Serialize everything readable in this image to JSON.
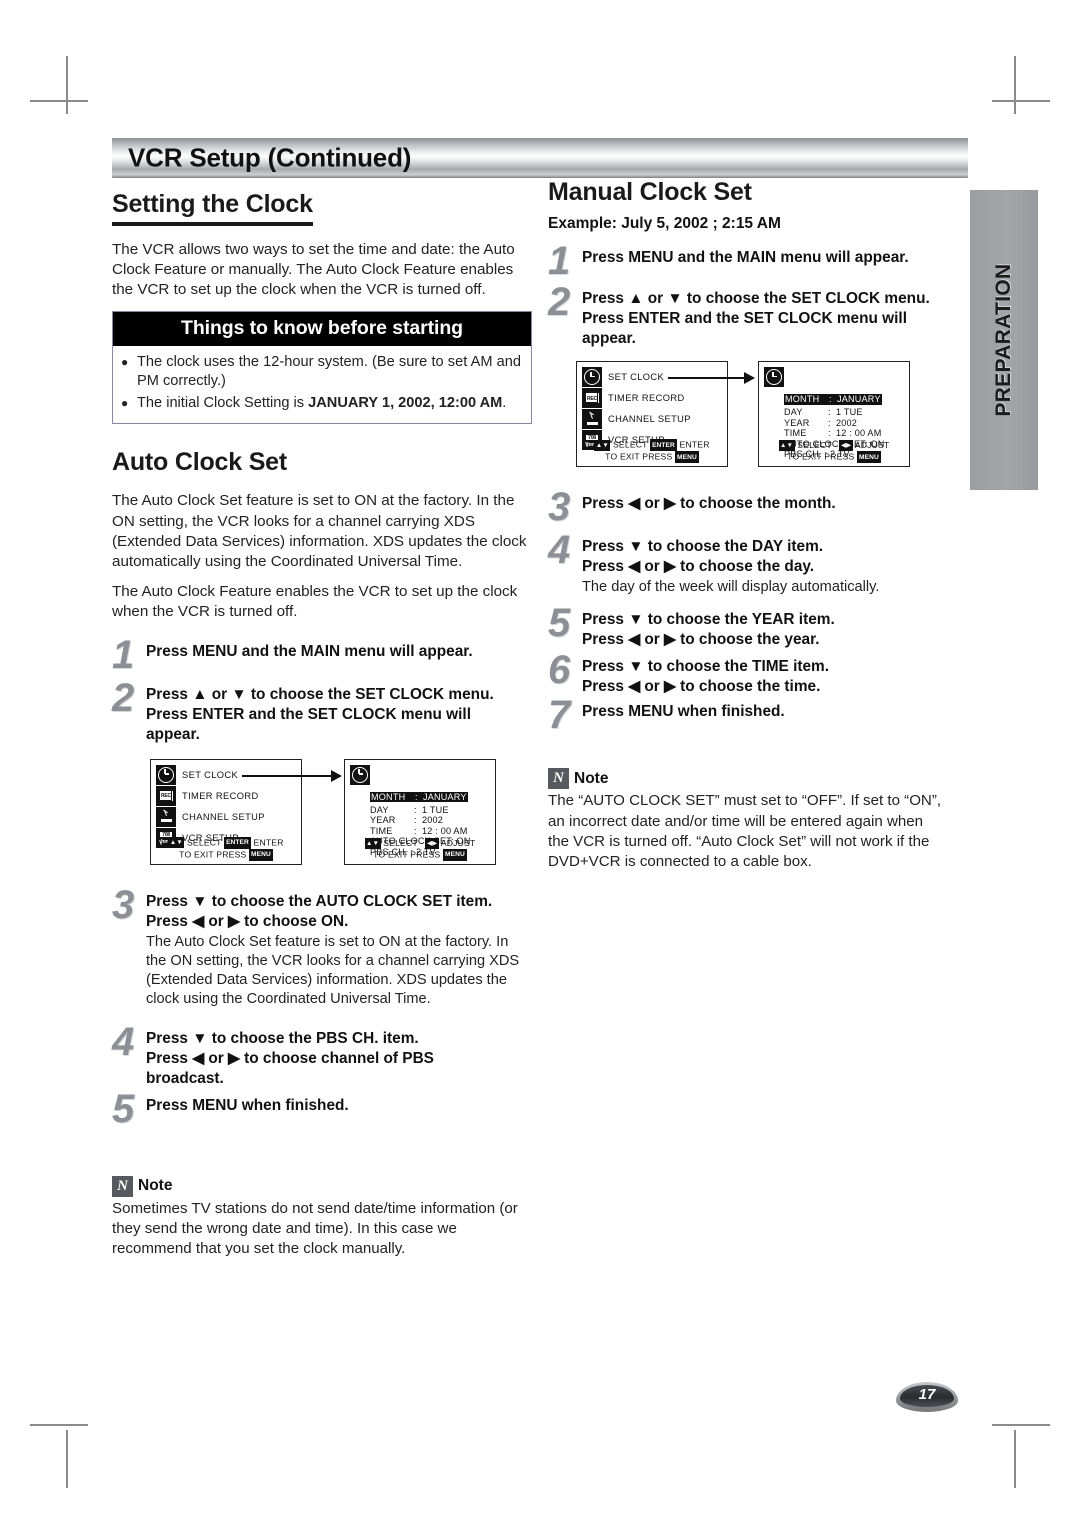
{
  "header": {
    "title": "VCR Setup (Continued)"
  },
  "side_tab": {
    "label": "PREPARATION"
  },
  "page_number": "17",
  "left_column": {
    "section_title": "Setting the Clock",
    "intro": "The VCR allows two ways to set the time and date: the Auto Clock Feature or manually. The Auto Clock Feature enables the VCR to set up the clock when the VCR is turned off.",
    "things_to_know": {
      "title": "Things to know before starting",
      "bullet_char": "●",
      "items": [
        {
          "text": "The clock uses the 12-hour system. (Be sure to set AM and PM correctly.)",
          "bold_tail": ""
        },
        {
          "text": "The initial Clock Setting is ",
          "bold_tail": "JANUARY 1, 2002, 12:00 AM",
          "after": "."
        }
      ]
    },
    "auto_clock": {
      "title": "Auto Clock Set",
      "paragraph_1": "The Auto Clock Set feature is set to ON at the factory. In the ON setting, the VCR looks for a channel carrying XDS (Extended Data Services) information. XDS updates the clock automatically using the Coordinated Universal Time.",
      "paragraph_2": "The Auto Clock Feature enables the VCR to set up the clock when the VCR is turned off.",
      "steps": [
        {
          "num": "1",
          "lines": [
            "Press MENU and the MAIN menu will appear."
          ],
          "sub": []
        },
        {
          "num": "2",
          "lines": [
            "Press ▲ or ▼ to choose the SET CLOCK menu.",
            "Press ENTER and the SET CLOCK menu will",
            "appear."
          ],
          "sub": []
        },
        {
          "num": "3",
          "lines": [
            "Press ▼ to choose the AUTO CLOCK SET item.",
            "Press ◀ or ▶ to choose ON."
          ],
          "sub": [
            "The Auto Clock Set feature is set to ON at the factory. In the ON setting, the VCR looks for a channel carrying XDS (Extended Data Services) information. XDS updates the clock using the Coordinated Universal Time."
          ]
        },
        {
          "num": "4",
          "lines": [
            "Press ▼ to choose the PBS CH. item.",
            "Press ◀ or ▶ to choose channel of PBS",
            "broadcast."
          ],
          "sub": []
        },
        {
          "num": "5",
          "lines": [
            "Press MENU when finished."
          ],
          "sub": []
        }
      ],
      "note": {
        "icon_letter": "N",
        "title": "Note",
        "body": "Sometimes TV stations do not send date/time information (or they send the wrong date and time). In this case we recommend that you set the clock manually."
      }
    }
  },
  "right_column": {
    "section_title": "Manual Clock Set",
    "example": "Example: July 5, 2002 ; 2:15 AM",
    "steps": [
      {
        "num": "1",
        "lines": [
          "Press MENU and the MAIN menu will appear."
        ],
        "sub": []
      },
      {
        "num": "2",
        "lines": [
          "Press ▲ or ▼ to choose the SET CLOCK menu.",
          "Press ENTER and the SET CLOCK menu will",
          "appear."
        ],
        "sub": []
      },
      {
        "num": "3",
        "lines": [
          "Press ◀ or ▶ to choose the month."
        ],
        "sub": []
      },
      {
        "num": "4",
        "lines": [
          "Press ▼ to choose the DAY item.",
          "Press ◀ or ▶ to choose the day."
        ],
        "sub": [
          "The day of the week will display automatically."
        ]
      },
      {
        "num": "5",
        "lines": [
          "Press ▼ to choose the YEAR item.",
          "Press ◀ or ▶ to choose the year."
        ],
        "sub": []
      },
      {
        "num": "6",
        "lines": [
          "Press ▼ to choose the TIME item.",
          "Press ◀ or ▶ to choose the time."
        ],
        "sub": []
      },
      {
        "num": "7",
        "lines": [
          "Press MENU when finished."
        ],
        "sub": []
      }
    ],
    "note": {
      "icon_letter": "N",
      "title": "Note",
      "body": "The “AUTO CLOCK SET” must set to “OFF”. If set to “ON”, an incorrect date and/or time will be entered again when the VCR is turned off. “Auto Clock Set” will not work if the DVD+VCR is connected to a cable box."
    }
  },
  "osd": {
    "main_menu": {
      "items": [
        {
          "icon": "clock-icon",
          "label": "SET  CLOCK"
        },
        {
          "icon": "rec-cassette-icon",
          "label": "TIMER RECORD"
        },
        {
          "icon": "channel-setup-icon",
          "label": "CHANNEL  SETUP"
        },
        {
          "icon": "vcr-setup-icon",
          "label": "VCR SETUP"
        }
      ],
      "footer_line1_select": "SELECT",
      "footer_line1_enter_key": "ENTER",
      "footer_line1_enter": "ENTER",
      "footer_line2_a": "TO  EXIT   PRESS",
      "footer_line2_key": "MENU"
    },
    "set_clock_menu": {
      "rows": [
        {
          "key": "MONTH",
          "sep": ":",
          "value": "JANUARY",
          "highlight": true
        },
        {
          "key": "DAY",
          "sep": ":",
          "value": "1   TUE",
          "highlight": false
        },
        {
          "key": "YEAR",
          "sep": ":",
          "value": "2002",
          "highlight": false
        },
        {
          "key": "TIME",
          "sep": ":",
          "value": "12 : 00  AM",
          "highlight": false
        },
        {
          "key": "AUTO CLOCK SET:",
          "sep": "",
          "value": "ON",
          "highlight": false
        },
        {
          "key": "PBS CH. :",
          "sep": "",
          "value": "2  TV",
          "highlight": false
        }
      ],
      "footer_select": "SELECT",
      "footer_adjust": "ADJUST",
      "footer_line2_a": "TO  EXIT   PRESS",
      "footer_line2_key": "MENU"
    }
  },
  "colors": {
    "accent_gray": "#8d8f97",
    "box_black": "#000000",
    "tab_gray": "#a3a5a9"
  }
}
